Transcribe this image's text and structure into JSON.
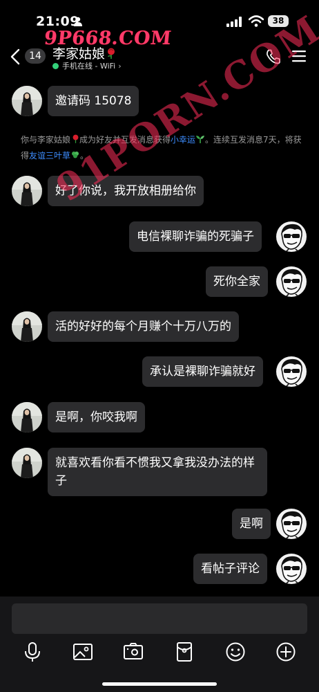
{
  "status_bar": {
    "time": "21:09",
    "battery": "38"
  },
  "watermark": {
    "top": "9P668.COM",
    "diagonal": "91PORN.COM"
  },
  "header": {
    "unread_count": "14",
    "contact_name": "李家姑娘",
    "online_status": "手机在线 - WiFi"
  },
  "system_message": {
    "part1": "你与李家姑娘",
    "part2": "成为好友并互发消息获得",
    "link1": "小幸运",
    "part3": "。连续互发消息7天，将获得",
    "link2": "友谊三叶草",
    "part4": "。"
  },
  "messages": [
    {
      "side": "left",
      "text": "邀请码 15078"
    },
    {
      "side": "left",
      "text": "好了你说，我开放相册给你"
    },
    {
      "side": "right",
      "text": "电信裸聊诈骗的死骗子"
    },
    {
      "side": "right",
      "text": "死你全家"
    },
    {
      "side": "left",
      "text": "活的好好的每个月赚个十万八万的"
    },
    {
      "side": "right",
      "text": "承认是裸聊诈骗就好"
    },
    {
      "side": "left",
      "text": "是啊，你咬我啊"
    },
    {
      "side": "left",
      "text": "就喜欢看你看不惯我又拿我没办法的样子"
    },
    {
      "side": "right",
      "text": "是啊"
    },
    {
      "side": "right",
      "text": "看帖子评论"
    }
  ],
  "colors": {
    "link": "#3d8dff",
    "bubble": "#2c2c2e",
    "online": "#33d17a",
    "watermark": "#ff3b6b"
  },
  "toolbar_icons": [
    "microphone-icon",
    "image-icon",
    "camera-icon",
    "red-packet-icon",
    "emoji-icon",
    "plus-icon"
  ]
}
